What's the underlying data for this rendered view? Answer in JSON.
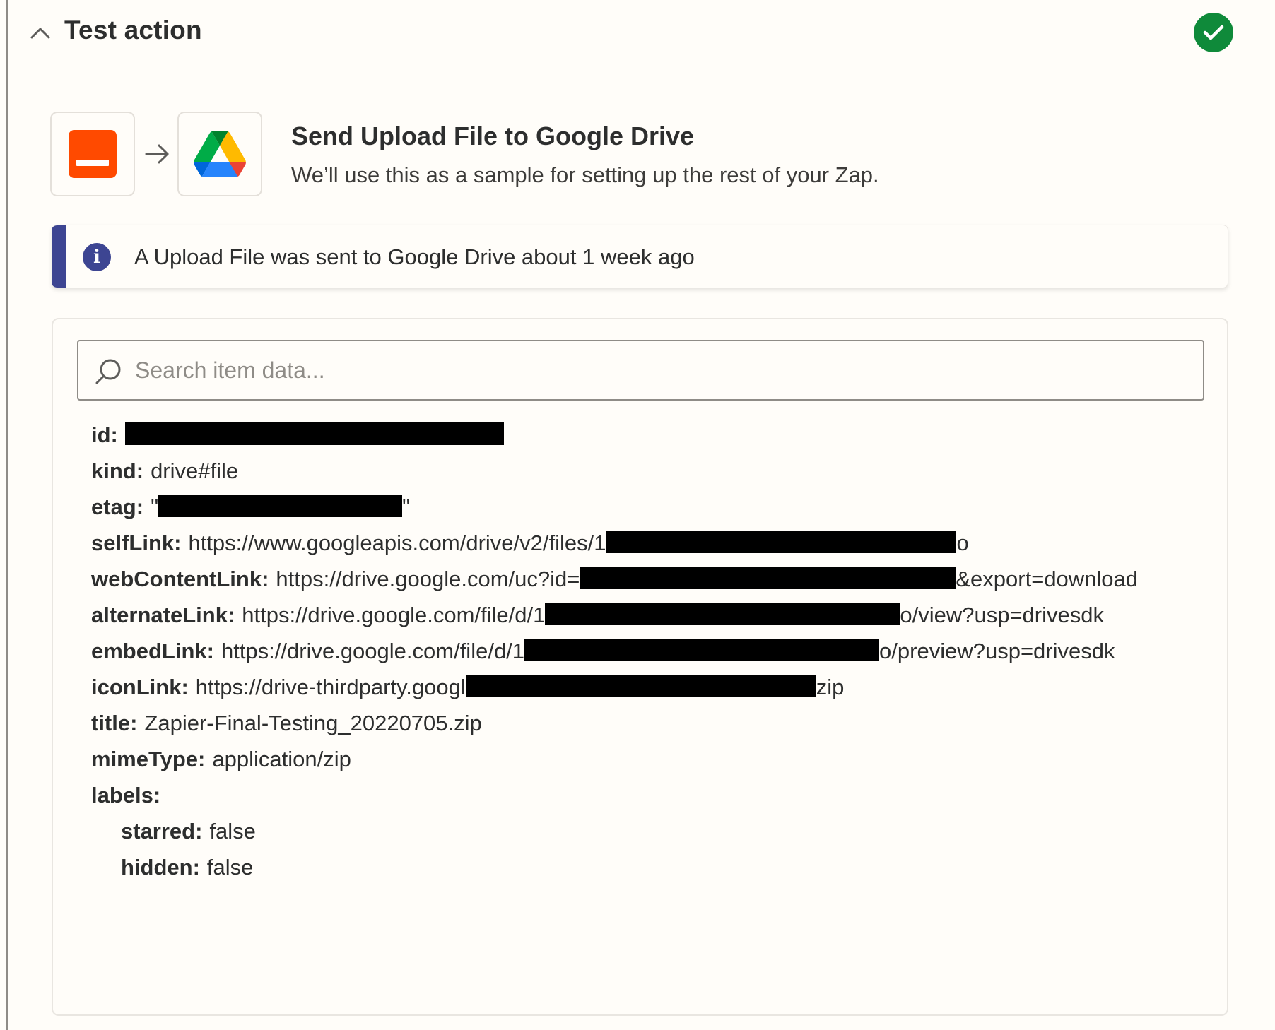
{
  "header": {
    "title": "Test action",
    "collapse_icon": "chevron-up-icon",
    "status_icon": "check-circle-icon",
    "status_color": "#0f8a3a"
  },
  "apps": {
    "source_icon": "webhook-app-icon",
    "source_color": "#ff4a00",
    "arrow_icon": "arrow-right-icon",
    "target_icon": "google-drive-icon"
  },
  "summary": {
    "title": "Send Upload File to Google Drive",
    "subtitle": "We’ll use this as a sample for setting up the rest of your Zap."
  },
  "banner": {
    "icon": "info-icon",
    "accent_color": "#3d4592",
    "text": "A Upload File was sent to Google Drive about 1 week ago"
  },
  "search": {
    "placeholder": "Search item data...",
    "value": ""
  },
  "fields": {
    "id": {
      "key": "id:"
    },
    "kind": {
      "key": "kind:",
      "value": "drive#file"
    },
    "etag": {
      "key": "etag:",
      "prefix": "\"",
      "suffix": "\""
    },
    "selfLink": {
      "key": "selfLink:",
      "prefix": "https://www.googleapis.com/drive/v2/files/1",
      "suffix": "o"
    },
    "webContentLink": {
      "key": "webContentLink:",
      "prefix": "https://drive.google.com/uc?id=",
      "suffix": "&export=download"
    },
    "alternateLink": {
      "key": "alternateLink:",
      "prefix": "https://drive.google.com/file/d/1",
      "suffix": "o/view?usp=drivesdk"
    },
    "embedLink": {
      "key": "embedLink:",
      "prefix": "https://drive.google.com/file/d/1",
      "suffix": "o/preview?usp=drivesdk"
    },
    "iconLink": {
      "key": "iconLink:",
      "prefix": "https://drive-thirdparty.googl",
      "suffix": "zip"
    },
    "title": {
      "key": "title:",
      "value": "Zapier-Final-Testing_20220705.zip"
    },
    "mimeType": {
      "key": "mimeType:",
      "value": "application/zip"
    },
    "labels": {
      "key": "labels:"
    },
    "starred": {
      "key": "starred:",
      "value": "false"
    },
    "hidden": {
      "key": "hidden:",
      "value": "false"
    }
  }
}
